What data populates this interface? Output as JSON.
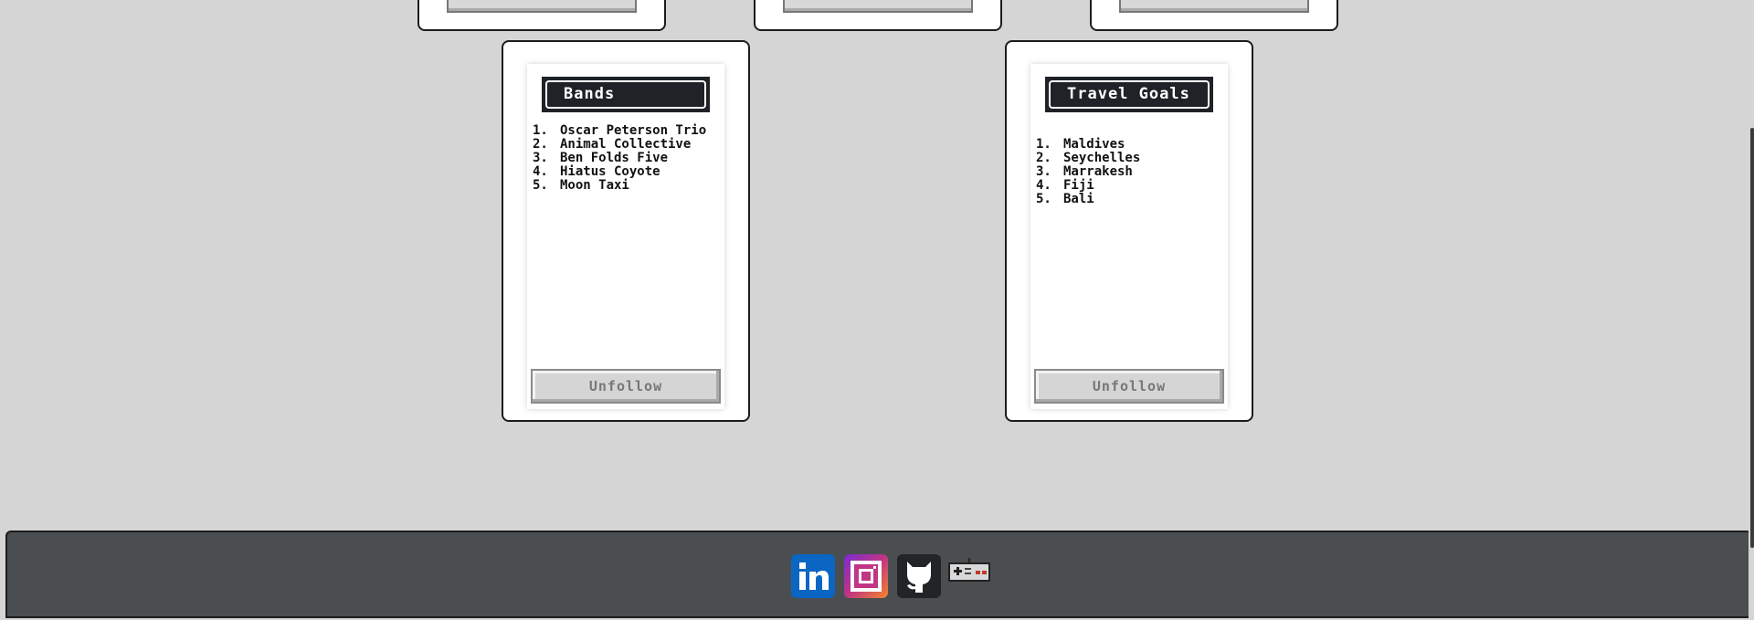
{
  "cards": [
    {
      "title": "Bands",
      "items": [
        "Oscar Peterson Trio",
        "Animal Collective",
        "Ben Folds Five",
        "Hiatus Coyote",
        "Moon Taxi"
      ],
      "button_label": "Unfollow"
    },
    {
      "title": "Travel Goals",
      "items": [
        "Maldives",
        "Seychelles",
        "Marrakesh",
        "Fiji",
        "Bali"
      ],
      "button_label": "Unfollow"
    }
  ],
  "footer": {
    "icons": [
      "linkedin-icon",
      "instagram-icon",
      "github-icon",
      "gamepad-icon"
    ]
  },
  "colors": {
    "background": "#d5d5d5",
    "footer": "#4b4e51",
    "title_bg": "#1f2226",
    "linkedin": "#0a66c2",
    "instagram": "#c13584"
  }
}
